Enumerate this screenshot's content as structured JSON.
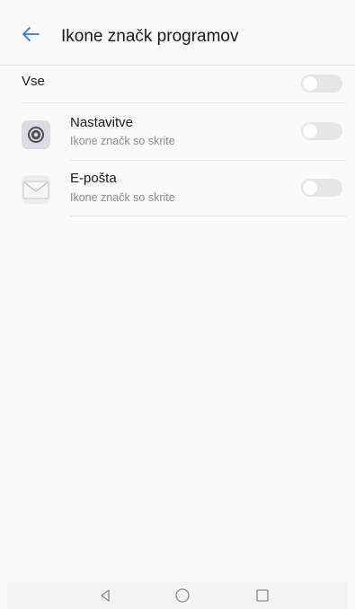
{
  "header": {
    "title": "Ikone značk programov",
    "back_icon": "arrow-left-icon",
    "accent_color": "#2a7de1"
  },
  "all_row": {
    "label": "Vse",
    "enabled": false
  },
  "apps": [
    {
      "name": "Nastavitve",
      "subtitle": "Ikone značk so skrite",
      "icon": "settings-app-icon",
      "enabled": false
    },
    {
      "name": "E-pošta",
      "subtitle": "Ikone značk so skrite",
      "icon": "email-app-icon",
      "enabled": false
    }
  ],
  "navbar": {
    "icons": [
      "back-triangle-icon",
      "home-circle-icon",
      "recents-square-icon"
    ]
  }
}
